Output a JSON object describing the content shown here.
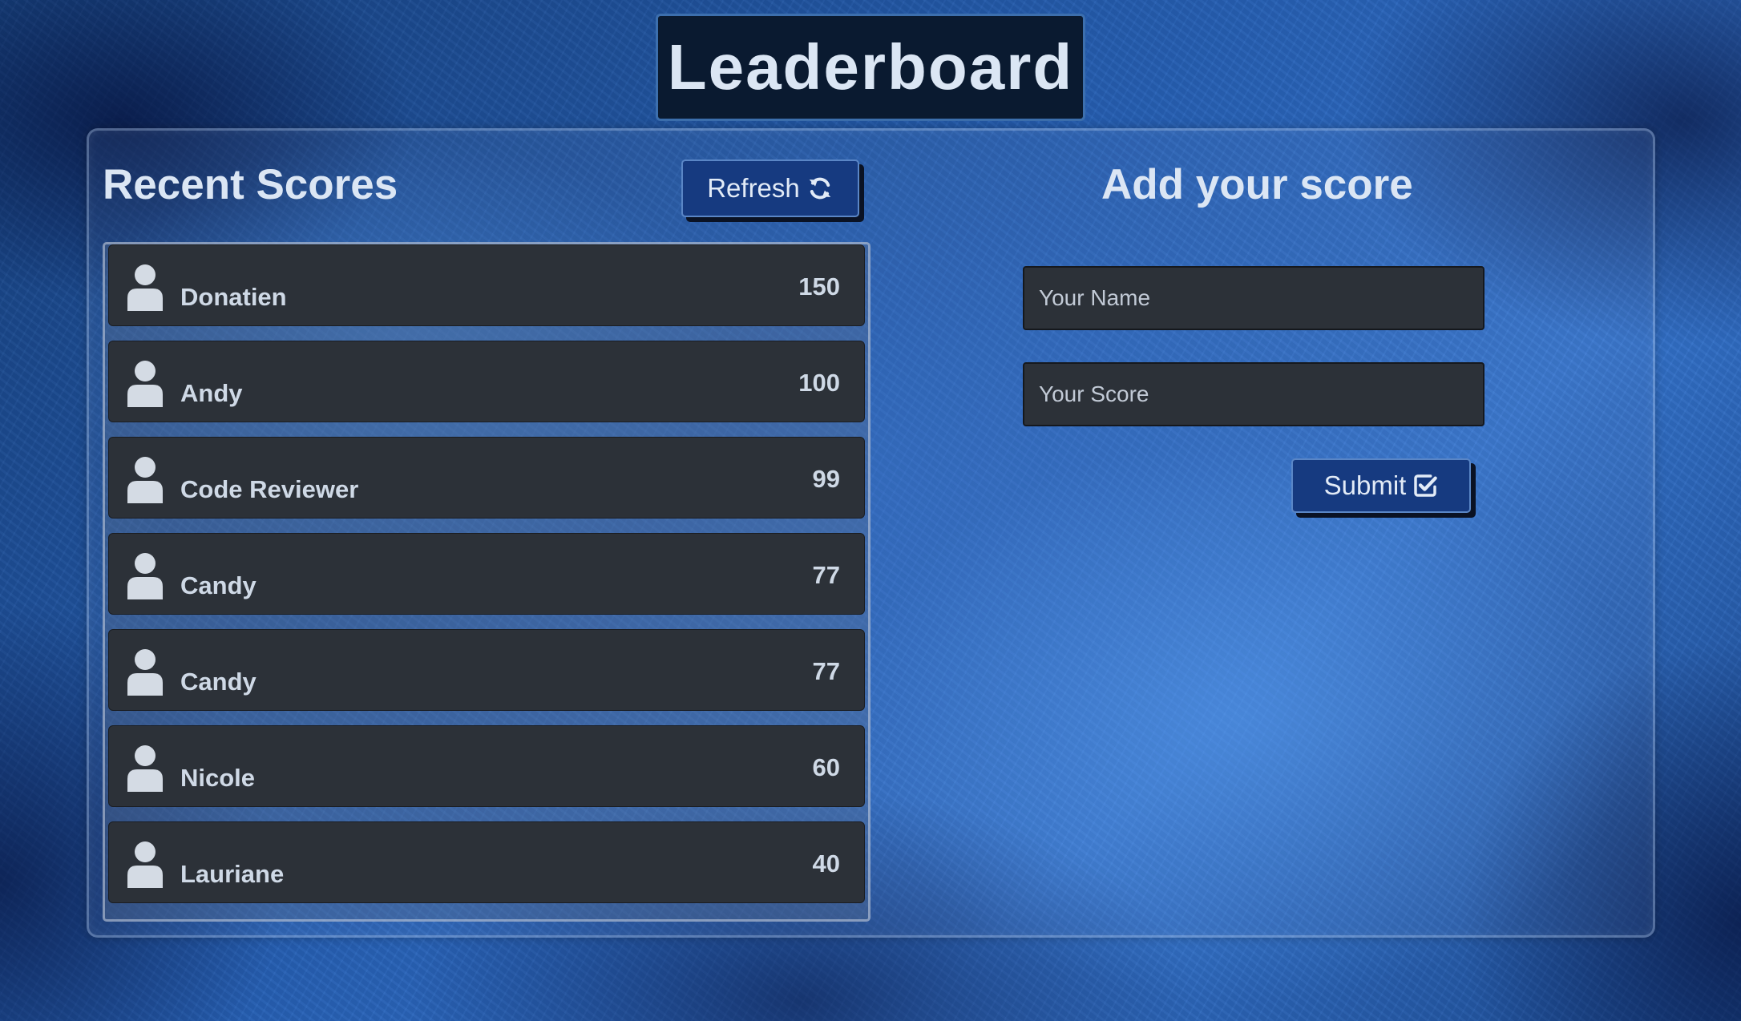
{
  "header": {
    "title": "Leaderboard"
  },
  "recent_scores": {
    "title": "Recent Scores",
    "refresh_label": "Refresh",
    "refresh_icon": "refresh-icon",
    "entries": [
      {
        "name": "Donatien",
        "score": "150"
      },
      {
        "name": "Andy",
        "score": "100"
      },
      {
        "name": "Code Reviewer",
        "score": "99"
      },
      {
        "name": "Candy",
        "score": "77"
      },
      {
        "name": "Candy",
        "score": "77"
      },
      {
        "name": "Nicole",
        "score": "60"
      },
      {
        "name": "Lauriane",
        "score": "40"
      }
    ]
  },
  "add_score": {
    "title": "Add your score",
    "name_placeholder": "Your Name",
    "name_value": "",
    "score_placeholder": "Your Score",
    "score_value": "",
    "submit_label": "Submit",
    "submit_icon": "check-square-icon"
  },
  "colors": {
    "title_bg": "#0a1a30",
    "button_bg": "#163a80",
    "row_bg": "#2c3138",
    "text_light": "#dbe6f4"
  }
}
